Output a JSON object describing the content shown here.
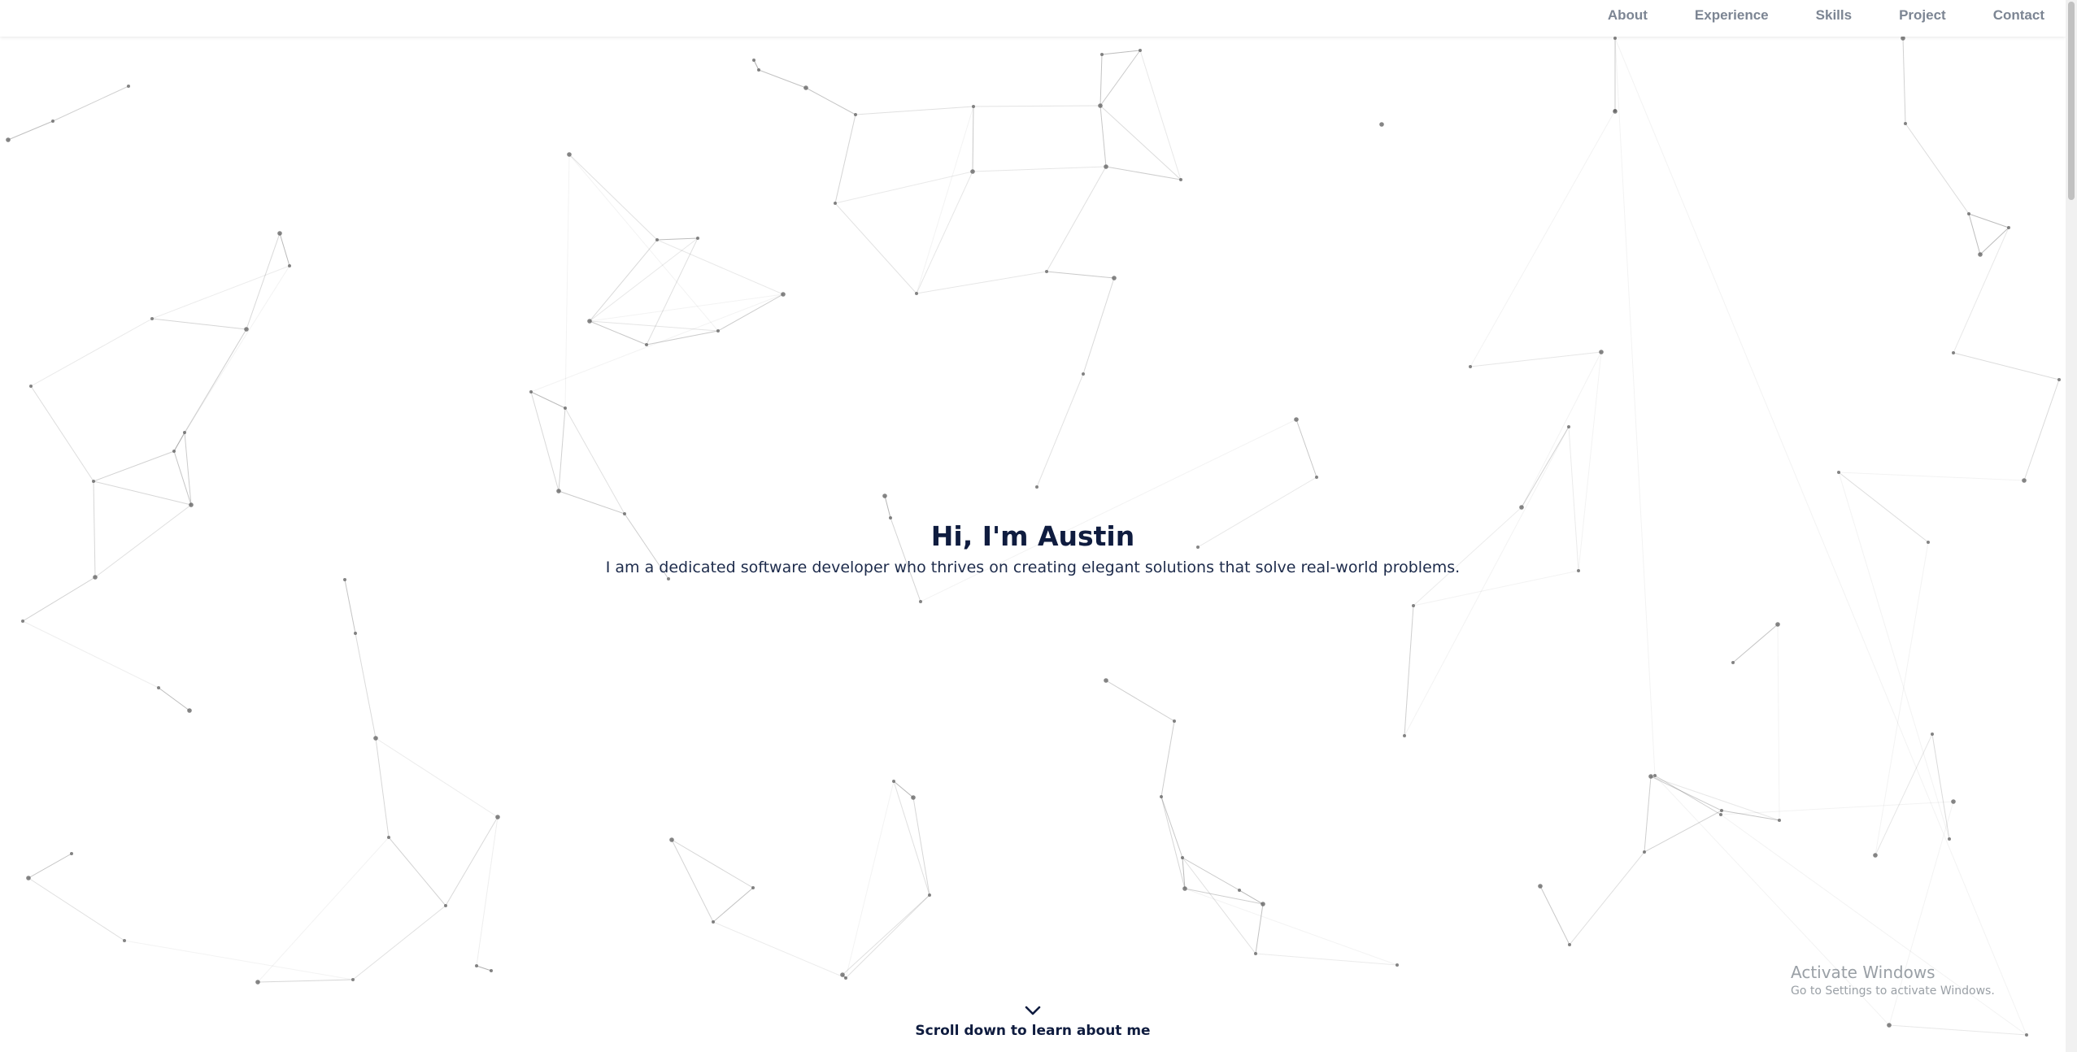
{
  "nav": {
    "items": [
      {
        "label": "About"
      },
      {
        "label": "Experience"
      },
      {
        "label": "Skills"
      },
      {
        "label": "Project"
      },
      {
        "label": "Contact"
      }
    ]
  },
  "hero": {
    "title": "Hi, I'm Austin",
    "subtitle": "I am a dedicated software developer who thrives on creating elegant solutions that solve real-world problems."
  },
  "scroll_cue": {
    "label": "Scroll down to learn about me",
    "icon": "chevron-down-icon"
  },
  "watermark": {
    "title": "Activate Windows",
    "subtitle": "Go to Settings to activate Windows."
  },
  "colors": {
    "text_dark": "#0f1c3f",
    "nav_text": "#7c8593",
    "particle": "#666666",
    "background": "#ffffff"
  }
}
